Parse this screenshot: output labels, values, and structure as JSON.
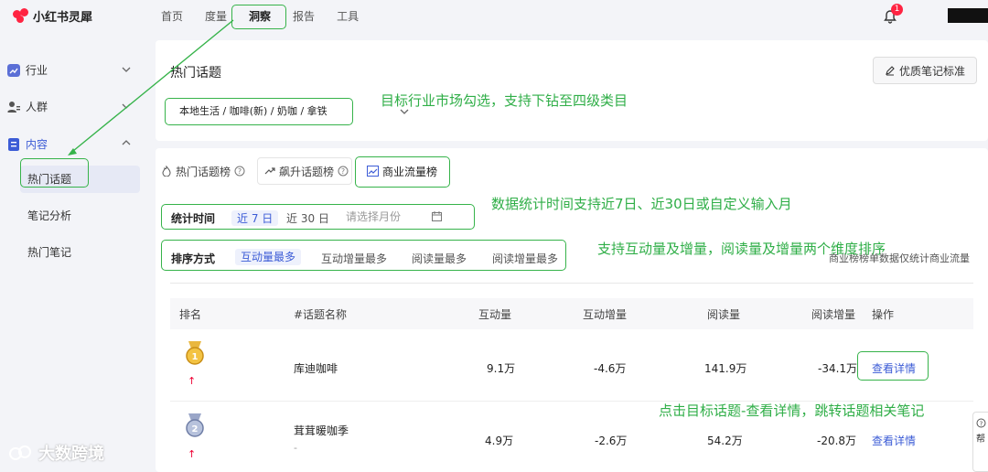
{
  "app": {
    "name": "小红书灵犀",
    "brand_color": "#ff2442"
  },
  "nav": {
    "items": [
      "首页",
      "度量",
      "洞察",
      "报告",
      "工具"
    ],
    "active": "洞察"
  },
  "notifications": {
    "count": "1"
  },
  "sidebar": {
    "groups": [
      {
        "label": "行业",
        "icon": "chart-icon"
      },
      {
        "label": "人群",
        "icon": "people-icon"
      },
      {
        "label": "内容",
        "icon": "document-icon"
      }
    ],
    "items": [
      "热门话题",
      "笔记分析",
      "热门笔记"
    ],
    "active_item": "热门话题"
  },
  "header": {
    "title": "热门话题",
    "quality_button": "优质笔记标准",
    "category": "本地生活 / 咖啡(新) / 奶咖 / 拿铁"
  },
  "tabs": [
    {
      "label": "热门话题榜",
      "icon": "fire-icon"
    },
    {
      "label": "飙升话题榜",
      "icon": "trend-icon"
    },
    {
      "label": "商业流量榜",
      "icon": "bar-chart-icon"
    }
  ],
  "active_tab": "商业流量榜",
  "time_filter": {
    "label": "统计时间",
    "options": [
      "近 7 日",
      "近 30 日"
    ],
    "active": "近 7 日",
    "month_placeholder": "请选择月份"
  },
  "sort_filter": {
    "label": "排序方式",
    "options": [
      "互动量最多",
      "互动增量最多",
      "阅读量最多",
      "阅读增量最多"
    ],
    "active": "互动量最多"
  },
  "note_right": "商业榜榜单数据仅统计商业流量",
  "table": {
    "columns": [
      "排名",
      "#话题名称",
      "互动量",
      "互动增量",
      "阅读量",
      "阅读增量",
      "操作"
    ],
    "rows": [
      {
        "rank_arrow": "↑",
        "name": "库迪咖啡",
        "sub": "",
        "interact": "9.1万",
        "interact_inc": "-4.6万",
        "read": "141.9万",
        "read_inc": "-34.1万",
        "action": "查看详情"
      },
      {
        "rank_arrow": "↑",
        "name": "茸茸暖咖季",
        "sub": "-",
        "interact": "4.9万",
        "interact_inc": "-2.6万",
        "read": "54.2万",
        "read_inc": "-20.8万",
        "action": "查看详情"
      }
    ]
  },
  "annotations": {
    "category": "目标行业市场勾选，支持下钻至四级类目",
    "time": "数据统计时间支持近7日、近30日或自定义输入月",
    "sort": "支持互动量及增量，阅读量及增量两个维度排序",
    "detail": "点击目标话题-查看详情，跳转话题相关笔记",
    "color": "#2fae47"
  },
  "help": {
    "label": "帮"
  },
  "watermark": "大数跨境"
}
